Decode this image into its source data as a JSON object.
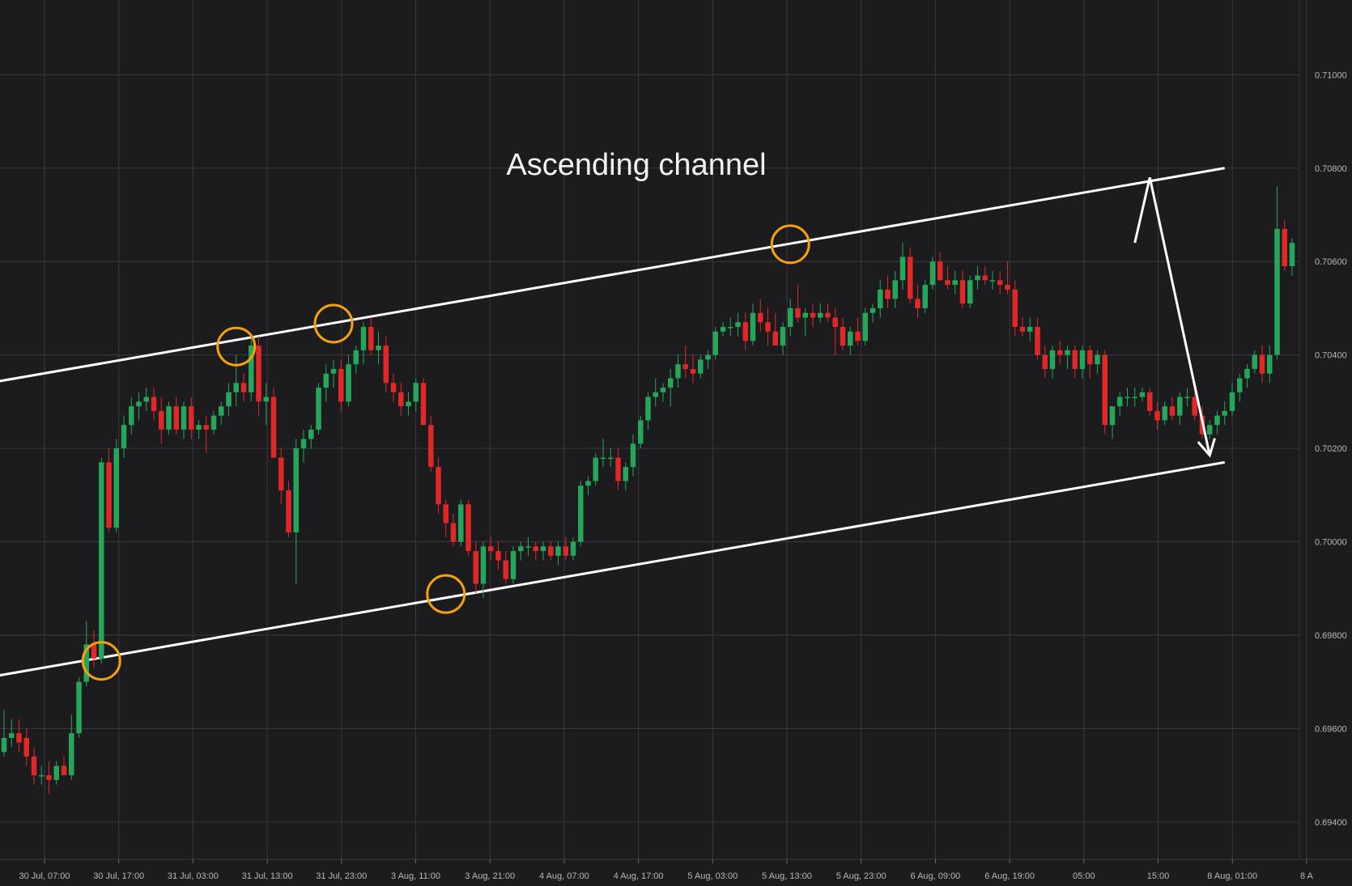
{
  "chart_data": {
    "type": "candlestick",
    "title": "",
    "annotation": "Ascending channel",
    "y_axis": {
      "range": [
        0.6932,
        0.7116
      ],
      "ticks": [
        "0.69400",
        "0.69600",
        "0.69800",
        "0.70000",
        "0.70200",
        "0.70400",
        "0.70600",
        "0.70800",
        "0.71000"
      ]
    },
    "x_axis": {
      "ticks": [
        "30 Jul, 07:00",
        "30 Jul, 17:00",
        "31 Jul, 03:00",
        "31 Jul, 13:00",
        "31 Jul, 23:00",
        "3 Aug, 11:00",
        "3 Aug, 21:00",
        "4 Aug, 07:00",
        "4 Aug, 17:00",
        "5 Aug, 03:00",
        "5 Aug, 13:00",
        "5 Aug, 23:00",
        "6 Aug, 09:00",
        "6 Aug, 19:00",
        "05:00",
        "15:00",
        "8 Aug, 01:00",
        "8 A"
      ]
    },
    "grid": true,
    "colors": {
      "up": "#26a65b",
      "down": "#e02828",
      "background": "#1c1c1f",
      "grid": "#3a3a3e",
      "channel": "#ffffff",
      "touch_marker": "#f5a10f"
    },
    "candles": [
      {
        "o": 0.6955,
        "h": 0.6964,
        "l": 0.6954,
        "c": 0.6958
      },
      {
        "o": 0.6958,
        "h": 0.6962,
        "l": 0.6956,
        "c": 0.6959
      },
      {
        "o": 0.6959,
        "h": 0.6962,
        "l": 0.6955,
        "c": 0.6957
      },
      {
        "o": 0.6958,
        "h": 0.696,
        "l": 0.6952,
        "c": 0.6954
      },
      {
        "o": 0.6954,
        "h": 0.6956,
        "l": 0.6948,
        "c": 0.695
      },
      {
        "o": 0.695,
        "h": 0.6952,
        "l": 0.6948,
        "c": 0.695
      },
      {
        "o": 0.695,
        "h": 0.6953,
        "l": 0.6946,
        "c": 0.6949
      },
      {
        "o": 0.6949,
        "h": 0.6953,
        "l": 0.6948,
        "c": 0.6952
      },
      {
        "o": 0.6952,
        "h": 0.6954,
        "l": 0.695,
        "c": 0.695
      },
      {
        "o": 0.695,
        "h": 0.6963,
        "l": 0.6949,
        "c": 0.6959
      },
      {
        "o": 0.6959,
        "h": 0.6971,
        "l": 0.6958,
        "c": 0.697
      },
      {
        "o": 0.697,
        "h": 0.6983,
        "l": 0.6969,
        "c": 0.6978
      },
      {
        "o": 0.6978,
        "h": 0.6981,
        "l": 0.6973,
        "c": 0.6975
      },
      {
        "o": 0.6975,
        "h": 0.7018,
        "l": 0.6974,
        "c": 0.7017
      },
      {
        "o": 0.7017,
        "h": 0.702,
        "l": 0.7002,
        "c": 0.7003
      },
      {
        "o": 0.7003,
        "h": 0.7022,
        "l": 0.7002,
        "c": 0.702
      },
      {
        "o": 0.702,
        "h": 0.7027,
        "l": 0.7018,
        "c": 0.7025
      },
      {
        "o": 0.7025,
        "h": 0.7031,
        "l": 0.7023,
        "c": 0.7029
      },
      {
        "o": 0.7029,
        "h": 0.7032,
        "l": 0.7026,
        "c": 0.703
      },
      {
        "o": 0.703,
        "h": 0.7033,
        "l": 0.7028,
        "c": 0.7031
      },
      {
        "o": 0.7031,
        "h": 0.7033,
        "l": 0.7026,
        "c": 0.7028
      },
      {
        "o": 0.7028,
        "h": 0.7031,
        "l": 0.7021,
        "c": 0.7024
      },
      {
        "o": 0.7024,
        "h": 0.703,
        "l": 0.7023,
        "c": 0.7029
      },
      {
        "o": 0.7029,
        "h": 0.7031,
        "l": 0.7023,
        "c": 0.7024
      },
      {
        "o": 0.7024,
        "h": 0.703,
        "l": 0.7022,
        "c": 0.7029
      },
      {
        "o": 0.7029,
        "h": 0.7031,
        "l": 0.7022,
        "c": 0.7024
      },
      {
        "o": 0.7024,
        "h": 0.7026,
        "l": 0.7022,
        "c": 0.7025
      },
      {
        "o": 0.7025,
        "h": 0.7027,
        "l": 0.7019,
        "c": 0.7024
      },
      {
        "o": 0.7024,
        "h": 0.7028,
        "l": 0.7023,
        "c": 0.7027
      },
      {
        "o": 0.7027,
        "h": 0.703,
        "l": 0.7025,
        "c": 0.7029
      },
      {
        "o": 0.7029,
        "h": 0.7034,
        "l": 0.7027,
        "c": 0.7032
      },
      {
        "o": 0.7032,
        "h": 0.704,
        "l": 0.7029,
        "c": 0.7034
      },
      {
        "o": 0.7034,
        "h": 0.7036,
        "l": 0.703,
        "c": 0.7032
      },
      {
        "o": 0.7032,
        "h": 0.7044,
        "l": 0.703,
        "c": 0.7042
      },
      {
        "o": 0.7042,
        "h": 0.7044,
        "l": 0.7027,
        "c": 0.703
      },
      {
        "o": 0.703,
        "h": 0.7034,
        "l": 0.7025,
        "c": 0.7031
      },
      {
        "o": 0.7031,
        "h": 0.7033,
        "l": 0.7018,
        "c": 0.7018
      },
      {
        "o": 0.7018,
        "h": 0.702,
        "l": 0.7008,
        "c": 0.7011
      },
      {
        "o": 0.7011,
        "h": 0.7013,
        "l": 0.7001,
        "c": 0.7002
      },
      {
        "o": 0.7002,
        "h": 0.7022,
        "l": 0.6991,
        "c": 0.702
      },
      {
        "o": 0.702,
        "h": 0.7024,
        "l": 0.7017,
        "c": 0.7022
      },
      {
        "o": 0.7022,
        "h": 0.7025,
        "l": 0.702,
        "c": 0.7024
      },
      {
        "o": 0.7024,
        "h": 0.7034,
        "l": 0.7023,
        "c": 0.7033
      },
      {
        "o": 0.7033,
        "h": 0.7038,
        "l": 0.703,
        "c": 0.7036
      },
      {
        "o": 0.7036,
        "h": 0.7039,
        "l": 0.7033,
        "c": 0.7037
      },
      {
        "o": 0.7037,
        "h": 0.7039,
        "l": 0.7028,
        "c": 0.703
      },
      {
        "o": 0.703,
        "h": 0.704,
        "l": 0.7029,
        "c": 0.7038
      },
      {
        "o": 0.7038,
        "h": 0.7042,
        "l": 0.7036,
        "c": 0.7041
      },
      {
        "o": 0.7041,
        "h": 0.7047,
        "l": 0.7038,
        "c": 0.7046
      },
      {
        "o": 0.7046,
        "h": 0.7048,
        "l": 0.704,
        "c": 0.7041
      },
      {
        "o": 0.7041,
        "h": 0.7045,
        "l": 0.7038,
        "c": 0.7042
      },
      {
        "o": 0.7042,
        "h": 0.7044,
        "l": 0.7032,
        "c": 0.7034
      },
      {
        "o": 0.7034,
        "h": 0.7036,
        "l": 0.703,
        "c": 0.7032
      },
      {
        "o": 0.7032,
        "h": 0.7034,
        "l": 0.7027,
        "c": 0.7029
      },
      {
        "o": 0.7029,
        "h": 0.7032,
        "l": 0.7027,
        "c": 0.703
      },
      {
        "o": 0.703,
        "h": 0.7035,
        "l": 0.7028,
        "c": 0.7034
      },
      {
        "o": 0.7034,
        "h": 0.7035,
        "l": 0.7025,
        "c": 0.7025
      },
      {
        "o": 0.7025,
        "h": 0.7027,
        "l": 0.7015,
        "c": 0.7016
      },
      {
        "o": 0.7016,
        "h": 0.7018,
        "l": 0.7006,
        "c": 0.7008
      },
      {
        "o": 0.7008,
        "h": 0.7009,
        "l": 0.7001,
        "c": 0.7004
      },
      {
        "o": 0.7004,
        "h": 0.7006,
        "l": 0.6999,
        "c": 0.7
      },
      {
        "o": 0.7,
        "h": 0.7009,
        "l": 0.6999,
        "c": 0.7008
      },
      {
        "o": 0.7008,
        "h": 0.7009,
        "l": 0.6997,
        "c": 0.6998
      },
      {
        "o": 0.6998,
        "h": 0.7,
        "l": 0.6989,
        "c": 0.6991
      },
      {
        "o": 0.6991,
        "h": 0.7,
        "l": 0.6988,
        "c": 0.6999
      },
      {
        "o": 0.6999,
        "h": 0.7001,
        "l": 0.6996,
        "c": 0.6998
      },
      {
        "o": 0.6998,
        "h": 0.7,
        "l": 0.6994,
        "c": 0.6996
      },
      {
        "o": 0.6996,
        "h": 0.6998,
        "l": 0.6991,
        "c": 0.6992
      },
      {
        "o": 0.6992,
        "h": 0.6999,
        "l": 0.6991,
        "c": 0.6998
      },
      {
        "o": 0.6998,
        "h": 0.7,
        "l": 0.6996,
        "c": 0.6999
      },
      {
        "o": 0.6999,
        "h": 0.7001,
        "l": 0.6997,
        "c": 0.6999
      },
      {
        "o": 0.6999,
        "h": 0.7,
        "l": 0.6996,
        "c": 0.6998
      },
      {
        "o": 0.6998,
        "h": 0.7,
        "l": 0.6996,
        "c": 0.6999
      },
      {
        "o": 0.6999,
        "h": 0.7,
        "l": 0.6996,
        "c": 0.6997
      },
      {
        "o": 0.6997,
        "h": 0.7,
        "l": 0.6995,
        "c": 0.6999
      },
      {
        "o": 0.6999,
        "h": 0.7001,
        "l": 0.6996,
        "c": 0.6997
      },
      {
        "o": 0.6997,
        "h": 0.7001,
        "l": 0.6996,
        "c": 0.7
      },
      {
        "o": 0.7,
        "h": 0.7013,
        "l": 0.6999,
        "c": 0.7012
      },
      {
        "o": 0.7012,
        "h": 0.7014,
        "l": 0.701,
        "c": 0.7013
      },
      {
        "o": 0.7013,
        "h": 0.7019,
        "l": 0.7012,
        "c": 0.7018
      },
      {
        "o": 0.7018,
        "h": 0.7022,
        "l": 0.7016,
        "c": 0.7018
      },
      {
        "o": 0.7018,
        "h": 0.702,
        "l": 0.7016,
        "c": 0.7018
      },
      {
        "o": 0.7018,
        "h": 0.702,
        "l": 0.7011,
        "c": 0.7013
      },
      {
        "o": 0.7013,
        "h": 0.7017,
        "l": 0.7011,
        "c": 0.7016
      },
      {
        "o": 0.7016,
        "h": 0.7023,
        "l": 0.7014,
        "c": 0.7021
      },
      {
        "o": 0.7021,
        "h": 0.7027,
        "l": 0.702,
        "c": 0.7026
      },
      {
        "o": 0.7026,
        "h": 0.7032,
        "l": 0.7024,
        "c": 0.7031
      },
      {
        "o": 0.7031,
        "h": 0.7035,
        "l": 0.7029,
        "c": 0.7032
      },
      {
        "o": 0.7032,
        "h": 0.7034,
        "l": 0.703,
        "c": 0.7033
      },
      {
        "o": 0.7033,
        "h": 0.7037,
        "l": 0.7029,
        "c": 0.7035
      },
      {
        "o": 0.7035,
        "h": 0.704,
        "l": 0.7033,
        "c": 0.7038
      },
      {
        "o": 0.7038,
        "h": 0.7042,
        "l": 0.7035,
        "c": 0.7037
      },
      {
        "o": 0.7037,
        "h": 0.704,
        "l": 0.7034,
        "c": 0.7036
      },
      {
        "o": 0.7036,
        "h": 0.704,
        "l": 0.7035,
        "c": 0.7039
      },
      {
        "o": 0.7039,
        "h": 0.7041,
        "l": 0.7037,
        "c": 0.704
      },
      {
        "o": 0.704,
        "h": 0.7046,
        "l": 0.7039,
        "c": 0.7045
      },
      {
        "o": 0.7045,
        "h": 0.7047,
        "l": 0.7044,
        "c": 0.7046
      },
      {
        "o": 0.7046,
        "h": 0.7048,
        "l": 0.7044,
        "c": 0.7046
      },
      {
        "o": 0.7046,
        "h": 0.7049,
        "l": 0.7044,
        "c": 0.7047
      },
      {
        "o": 0.7047,
        "h": 0.7049,
        "l": 0.7041,
        "c": 0.7043
      },
      {
        "o": 0.7043,
        "h": 0.7051,
        "l": 0.7042,
        "c": 0.7049
      },
      {
        "o": 0.7049,
        "h": 0.7052,
        "l": 0.7045,
        "c": 0.7047
      },
      {
        "o": 0.7047,
        "h": 0.705,
        "l": 0.7042,
        "c": 0.7045
      },
      {
        "o": 0.7045,
        "h": 0.7049,
        "l": 0.7042,
        "c": 0.7042
      },
      {
        "o": 0.7042,
        "h": 0.7047,
        "l": 0.704,
        "c": 0.7046
      },
      {
        "o": 0.7046,
        "h": 0.7052,
        "l": 0.7044,
        "c": 0.705
      },
      {
        "o": 0.705,
        "h": 0.7055,
        "l": 0.7047,
        "c": 0.7048
      },
      {
        "o": 0.7048,
        "h": 0.705,
        "l": 0.7044,
        "c": 0.7049
      },
      {
        "o": 0.7049,
        "h": 0.7051,
        "l": 0.7046,
        "c": 0.7048
      },
      {
        "o": 0.7048,
        "h": 0.7051,
        "l": 0.7047,
        "c": 0.7049
      },
      {
        "o": 0.7049,
        "h": 0.7051,
        "l": 0.7047,
        "c": 0.7048
      },
      {
        "o": 0.7048,
        "h": 0.705,
        "l": 0.704,
        "c": 0.7046
      },
      {
        "o": 0.7046,
        "h": 0.7048,
        "l": 0.7041,
        "c": 0.7042
      },
      {
        "o": 0.7042,
        "h": 0.7046,
        "l": 0.704,
        "c": 0.7045
      },
      {
        "o": 0.7045,
        "h": 0.7048,
        "l": 0.7042,
        "c": 0.7043
      },
      {
        "o": 0.7043,
        "h": 0.705,
        "l": 0.7042,
        "c": 0.7049
      },
      {
        "o": 0.7049,
        "h": 0.7051,
        "l": 0.7047,
        "c": 0.705
      },
      {
        "o": 0.705,
        "h": 0.7056,
        "l": 0.7048,
        "c": 0.7054
      },
      {
        "o": 0.7054,
        "h": 0.7057,
        "l": 0.705,
        "c": 0.7052
      },
      {
        "o": 0.7052,
        "h": 0.7058,
        "l": 0.705,
        "c": 0.7056
      },
      {
        "o": 0.7056,
        "h": 0.7064,
        "l": 0.7054,
        "c": 0.7061
      },
      {
        "o": 0.7061,
        "h": 0.7063,
        "l": 0.7051,
        "c": 0.7052
      },
      {
        "o": 0.7052,
        "h": 0.7055,
        "l": 0.7048,
        "c": 0.705
      },
      {
        "o": 0.705,
        "h": 0.7056,
        "l": 0.7049,
        "c": 0.7055
      },
      {
        "o": 0.7055,
        "h": 0.7061,
        "l": 0.7054,
        "c": 0.706
      },
      {
        "o": 0.706,
        "h": 0.7062,
        "l": 0.7056,
        "c": 0.7056
      },
      {
        "o": 0.7056,
        "h": 0.7059,
        "l": 0.7054,
        "c": 0.7055
      },
      {
        "o": 0.7055,
        "h": 0.7058,
        "l": 0.7053,
        "c": 0.7056
      },
      {
        "o": 0.7056,
        "h": 0.7058,
        "l": 0.705,
        "c": 0.7051
      },
      {
        "o": 0.7051,
        "h": 0.7057,
        "l": 0.705,
        "c": 0.7056
      },
      {
        "o": 0.7056,
        "h": 0.7059,
        "l": 0.7054,
        "c": 0.7057
      },
      {
        "o": 0.7057,
        "h": 0.7059,
        "l": 0.7055,
        "c": 0.7056
      },
      {
        "o": 0.7056,
        "h": 0.7058,
        "l": 0.7054,
        "c": 0.7056
      },
      {
        "o": 0.7056,
        "h": 0.7058,
        "l": 0.7053,
        "c": 0.7055
      },
      {
        "o": 0.7055,
        "h": 0.706,
        "l": 0.7053,
        "c": 0.7054
      },
      {
        "o": 0.7054,
        "h": 0.7056,
        "l": 0.7044,
        "c": 0.7046
      },
      {
        "o": 0.7046,
        "h": 0.7048,
        "l": 0.7044,
        "c": 0.7045
      },
      {
        "o": 0.7045,
        "h": 0.7048,
        "l": 0.7043,
        "c": 0.7046
      },
      {
        "o": 0.7046,
        "h": 0.7048,
        "l": 0.7039,
        "c": 0.704
      },
      {
        "o": 0.704,
        "h": 0.7042,
        "l": 0.7035,
        "c": 0.7037
      },
      {
        "o": 0.7037,
        "h": 0.7042,
        "l": 0.7035,
        "c": 0.7041
      },
      {
        "o": 0.7041,
        "h": 0.7043,
        "l": 0.7038,
        "c": 0.704
      },
      {
        "o": 0.704,
        "h": 0.7042,
        "l": 0.7037,
        "c": 0.7041
      },
      {
        "o": 0.7041,
        "h": 0.7042,
        "l": 0.7035,
        "c": 0.7037
      },
      {
        "o": 0.7037,
        "h": 0.7042,
        "l": 0.7035,
        "c": 0.7041
      },
      {
        "o": 0.7041,
        "h": 0.7042,
        "l": 0.7035,
        "c": 0.7038
      },
      {
        "o": 0.7038,
        "h": 0.7041,
        "l": 0.7036,
        "c": 0.704
      },
      {
        "o": 0.704,
        "h": 0.7041,
        "l": 0.7023,
        "c": 0.7025
      },
      {
        "o": 0.7025,
        "h": 0.7029,
        "l": 0.7022,
        "c": 0.7029
      },
      {
        "o": 0.7029,
        "h": 0.7032,
        "l": 0.7027,
        "c": 0.7031
      },
      {
        "o": 0.7031,
        "h": 0.7033,
        "l": 0.7029,
        "c": 0.7031
      },
      {
        "o": 0.7031,
        "h": 0.7033,
        "l": 0.7029,
        "c": 0.7031
      },
      {
        "o": 0.7031,
        "h": 0.7033,
        "l": 0.703,
        "c": 0.7032
      },
      {
        "o": 0.7032,
        "h": 0.7033,
        "l": 0.7027,
        "c": 0.7028
      },
      {
        "o": 0.7028,
        "h": 0.703,
        "l": 0.7024,
        "c": 0.7026
      },
      {
        "o": 0.7026,
        "h": 0.703,
        "l": 0.7025,
        "c": 0.7029
      },
      {
        "o": 0.7029,
        "h": 0.7031,
        "l": 0.7026,
        "c": 0.7027
      },
      {
        "o": 0.7027,
        "h": 0.7032,
        "l": 0.7025,
        "c": 0.7031
      },
      {
        "o": 0.7031,
        "h": 0.7033,
        "l": 0.7029,
        "c": 0.7031
      },
      {
        "o": 0.7031,
        "h": 0.7033,
        "l": 0.7026,
        "c": 0.7027
      },
      {
        "o": 0.7027,
        "h": 0.7029,
        "l": 0.7022,
        "c": 0.7023
      },
      {
        "o": 0.7023,
        "h": 0.7026,
        "l": 0.7022,
        "c": 0.7025
      },
      {
        "o": 0.7025,
        "h": 0.7028,
        "l": 0.7023,
        "c": 0.7027
      },
      {
        "o": 0.7027,
        "h": 0.703,
        "l": 0.7025,
        "c": 0.7028
      },
      {
        "o": 0.7028,
        "h": 0.7034,
        "l": 0.7027,
        "c": 0.7032
      },
      {
        "o": 0.7032,
        "h": 0.7036,
        "l": 0.703,
        "c": 0.7035
      },
      {
        "o": 0.7035,
        "h": 0.7038,
        "l": 0.7033,
        "c": 0.7037
      },
      {
        "o": 0.7037,
        "h": 0.7041,
        "l": 0.7036,
        "c": 0.704
      },
      {
        "o": 0.704,
        "h": 0.7042,
        "l": 0.7034,
        "c": 0.7036
      },
      {
        "o": 0.7036,
        "h": 0.7042,
        "l": 0.7034,
        "c": 0.704
      },
      {
        "o": 0.704,
        "h": 0.7076,
        "l": 0.7039,
        "c": 0.7067
      },
      {
        "o": 0.7067,
        "h": 0.7069,
        "l": 0.7058,
        "c": 0.7059
      },
      {
        "o": 0.7059,
        "h": 0.7065,
        "l": 0.7057,
        "c": 0.7064
      }
    ],
    "channel": {
      "upper": [
        [
          -2,
          0.7034
        ],
        [
          163,
          0.708
        ]
      ],
      "lower": [
        [
          -2,
          0.6971
        ],
        [
          163,
          0.7017
        ]
      ]
    },
    "touch_points": [
      {
        "candle": 13,
        "price": 0.69745
      },
      {
        "candle": 31,
        "price": 0.70418
      },
      {
        "candle": 44,
        "price": 0.70467
      },
      {
        "candle": 59,
        "price": 0.69888
      },
      {
        "candle": 105,
        "price": 0.70637
      }
    ],
    "projection_arrow": [
      [
        151,
        0.7064
      ],
      [
        153,
        0.7078
      ],
      [
        161,
        0.70185
      ]
    ]
  }
}
